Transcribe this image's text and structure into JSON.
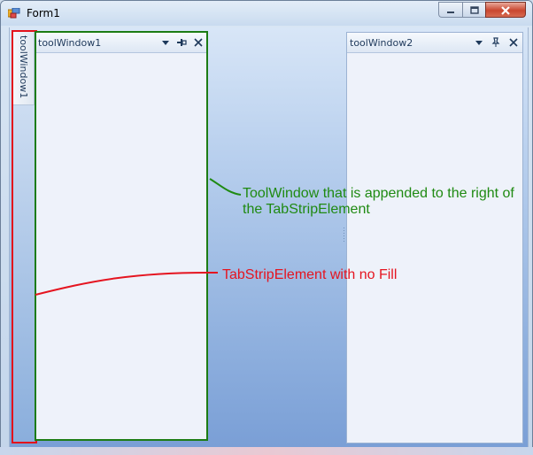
{
  "window": {
    "title": "Form1",
    "controls": {
      "minimize_icon": "minimize-icon",
      "maximize_icon": "maximize-icon",
      "close_icon": "close-icon"
    }
  },
  "tabstrip": {
    "tab_label": "toolWindow1"
  },
  "tool_windows": [
    {
      "title": "toolWindow1",
      "icons": [
        "chevron-down-icon",
        "pin-icon",
        "close-icon"
      ]
    },
    {
      "title": "toolWindow2",
      "icons": [
        "chevron-down-icon",
        "pin-icon",
        "close-icon"
      ]
    }
  ],
  "annotations": {
    "green": "ToolWindow that is appended to the right of the TabStripElement",
    "red": "TabStripElement with no Fill"
  },
  "colors": {
    "green_annotation": "#1f8a12",
    "red_annotation": "#e5141f"
  }
}
